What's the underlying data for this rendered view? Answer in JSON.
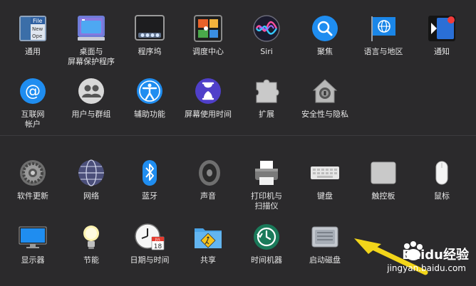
{
  "row1": [
    {
      "id": "general",
      "label": "通用",
      "icon": "general-icon",
      "file_label": "File",
      "new_label": "New",
      "open_label": "Ope"
    },
    {
      "id": "desktop",
      "label": "桌面与\n屏幕保护程序",
      "icon": "desktop-screensaver-icon"
    },
    {
      "id": "dock",
      "label": "程序坞",
      "icon": "dock-icon"
    },
    {
      "id": "mission",
      "label": "调度中心",
      "icon": "mission-control-icon"
    },
    {
      "id": "siri",
      "label": "Siri",
      "icon": "siri-icon"
    },
    {
      "id": "spotlight",
      "label": "聚焦",
      "icon": "spotlight-icon"
    },
    {
      "id": "language",
      "label": "语言与地区",
      "icon": "globe-flag-icon"
    },
    {
      "id": "notifications",
      "label": "通知",
      "icon": "notifications-icon"
    }
  ],
  "row2": [
    {
      "id": "internet",
      "label": "互联网\n帐户",
      "icon": "at-icon"
    },
    {
      "id": "users",
      "label": "用户与群组",
      "icon": "users-icon"
    },
    {
      "id": "accessibility",
      "label": "辅助功能",
      "icon": "accessibility-icon"
    },
    {
      "id": "screentime",
      "label": "屏幕使用时间",
      "icon": "hourglass-icon"
    },
    {
      "id": "extensions",
      "label": "扩展",
      "icon": "puzzle-icon"
    },
    {
      "id": "security",
      "label": "安全性与隐私",
      "icon": "house-lock-icon"
    }
  ],
  "row3": [
    {
      "id": "swupdate",
      "label": "软件更新",
      "icon": "gear-icon"
    },
    {
      "id": "network",
      "label": "网络",
      "icon": "network-globe-icon"
    },
    {
      "id": "bluetooth",
      "label": "蓝牙",
      "icon": "bluetooth-icon"
    },
    {
      "id": "sound",
      "label": "声音",
      "icon": "speaker-icon"
    },
    {
      "id": "printers",
      "label": "打印机与\n扫描仪",
      "icon": "printer-icon"
    },
    {
      "id": "keyboard",
      "label": "键盘",
      "icon": "keyboard-icon"
    },
    {
      "id": "trackpad",
      "label": "触控板",
      "icon": "trackpad-icon"
    },
    {
      "id": "mouse",
      "label": "鼠标",
      "icon": "mouse-icon"
    }
  ],
  "row4": [
    {
      "id": "displays",
      "label": "显示器",
      "icon": "display-icon"
    },
    {
      "id": "energy",
      "label": "节能",
      "icon": "lightbulb-icon"
    },
    {
      "id": "datetime",
      "label": "日期与时间",
      "icon": "clock-calendar-icon",
      "cal_month": "JUL",
      "cal_day": "18"
    },
    {
      "id": "sharing",
      "label": "共享",
      "icon": "sharing-folder-icon"
    },
    {
      "id": "timemachine",
      "label": "时间机器",
      "icon": "time-machine-icon"
    },
    {
      "id": "startup",
      "label": "启动磁盘",
      "icon": "hard-disk-icon"
    }
  ],
  "watermark": {
    "brand": "Baidu经验",
    "url": "jingyan.baidu.com",
    "icon": "baidu-paw-icon"
  },
  "colors": {
    "bg": "#2b2a2c",
    "label": "#e6e6e6",
    "arrow": "#f2d51a"
  }
}
